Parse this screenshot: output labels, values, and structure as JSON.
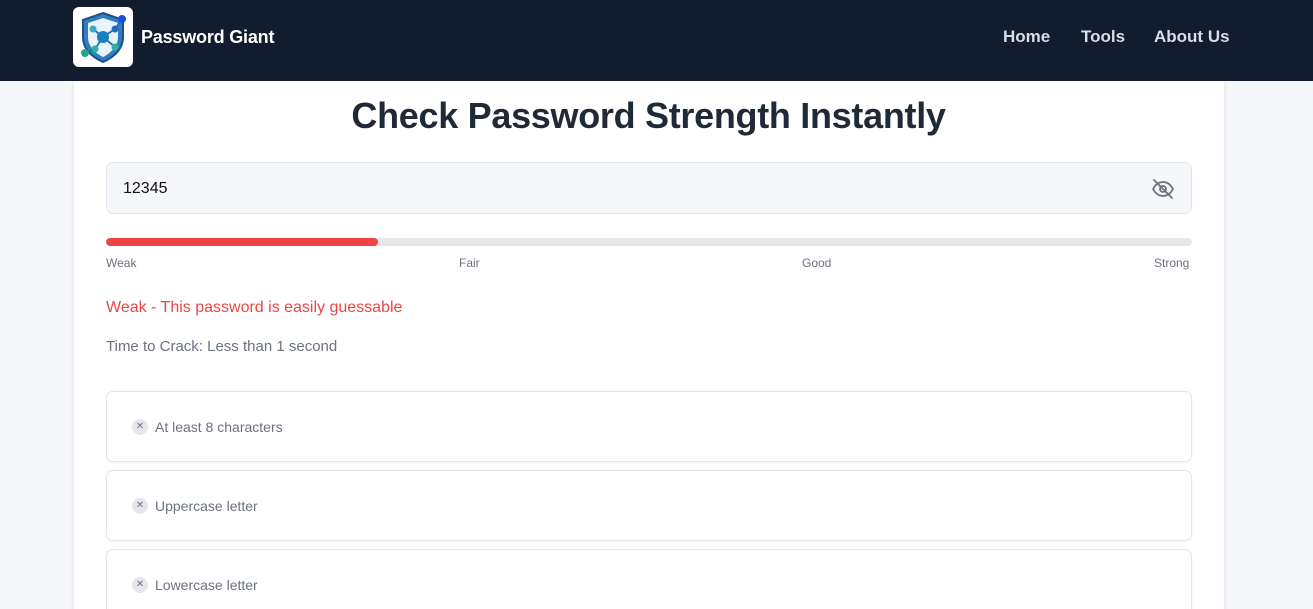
{
  "colors": {
    "nav_bg": "#111d2f",
    "accent_weak": "#ef4444",
    "muted_text": "#6b7280",
    "title_text": "#1f2937"
  },
  "header": {
    "logo_icon": "shield-network-icon",
    "brand": "Password Giant",
    "nav": [
      {
        "label": "Home"
      },
      {
        "label": "Tools"
      },
      {
        "label": "About Us"
      }
    ]
  },
  "main": {
    "title": "Check Password Strength Instantly",
    "password_input": {
      "value": "12345",
      "toggle_icon": "eye-off-icon"
    },
    "meter": {
      "fill_fraction": 0.25,
      "labels": [
        "Weak",
        "Fair",
        "Good",
        "Strong"
      ]
    },
    "strength_text": "Weak - This password is easily guessable",
    "crack_time": "Time to Crack: Less than 1 second",
    "requirements": [
      {
        "label": "At least 8 characters",
        "met": false,
        "icon": "x-icon"
      },
      {
        "label": "Uppercase letter",
        "met": false,
        "icon": "x-icon"
      },
      {
        "label": "Lowercase letter",
        "met": false,
        "icon": "x-icon"
      }
    ]
  }
}
